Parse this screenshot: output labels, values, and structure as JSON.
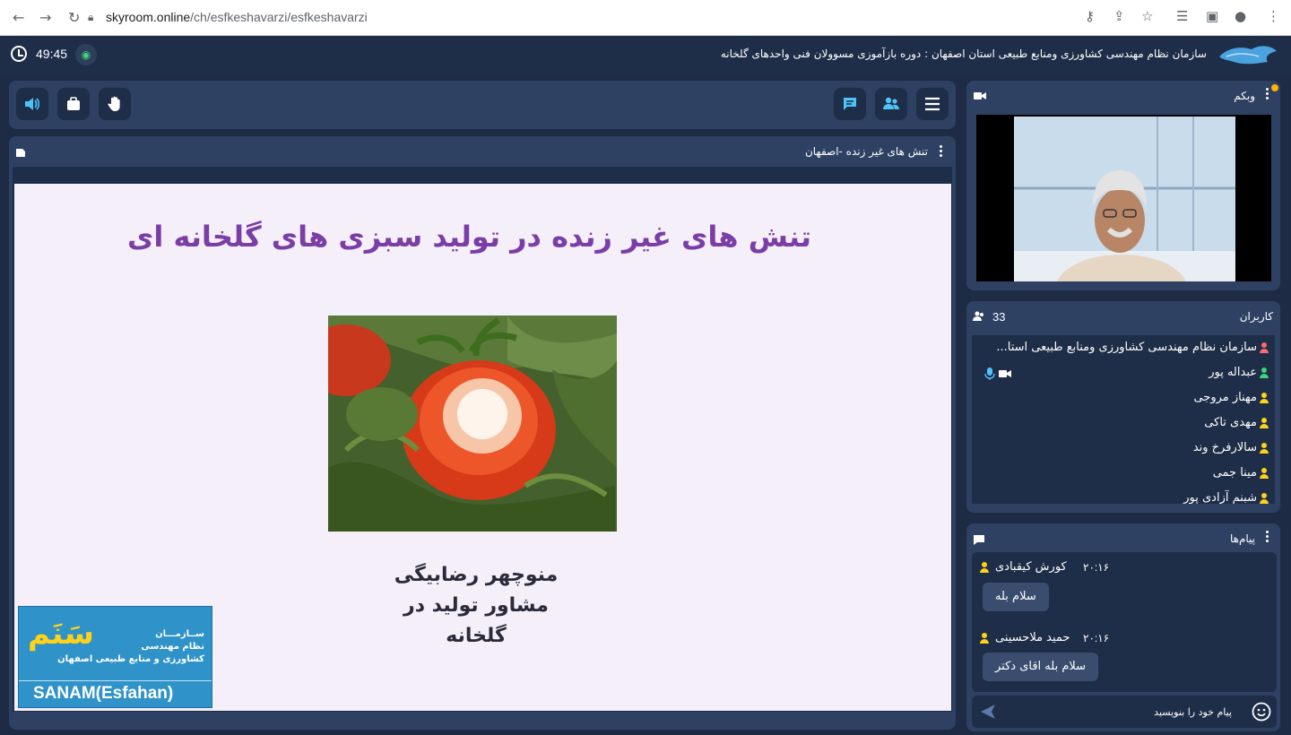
{
  "browser": {
    "url_host": "skyroom.online",
    "url_path": "/ch/esfkeshavarzi/esfkeshavarzi"
  },
  "header": {
    "title": "سازمان نظام مهندسی کشاورزی ومنابع طبیعی استان اصفهان : دوره بازآموزی مسوولان فنی واحدهای گلخانه",
    "timer": "49:45"
  },
  "slide_panel": {
    "title": "تنش های غیر زنده -اصفهان"
  },
  "slide": {
    "title": "تنش های غیر زنده در تولید سبزی های گلخانه ای",
    "presenter_name": "منوچهر رضابیگی",
    "presenter_role": "مشاور تولید در گلخانه"
  },
  "sanam": {
    "big": "سَنَم",
    "line1": "ســازمـــان",
    "line2": "نظام مهندسی",
    "line3": "کشاورزی و منابع طبیعی اصفهان",
    "en": "SANAM(Esfahan)"
  },
  "webcam": {
    "title": "وبکم"
  },
  "users": {
    "title": "کاربران",
    "count": "33",
    "items": [
      {
        "name": "سازمان نظام مهندسی کشاورزی ومنابع طبیعی استا...",
        "color": "#ff6b6b"
      },
      {
        "name": "عبداله پور",
        "color": "#3fd37a"
      },
      {
        "name": "مهناز مروجی",
        "color": "#ffd21a"
      },
      {
        "name": "مهدی تاکی",
        "color": "#ffd21a"
      },
      {
        "name": "سالارفرخ وند",
        "color": "#ffd21a"
      },
      {
        "name": "مینا جمی",
        "color": "#ffd21a"
      },
      {
        "name": "شبنم آزادی پور",
        "color": "#ffd21a"
      }
    ]
  },
  "messages": {
    "title": "پیام‌ها",
    "items": [
      {
        "name": "کورش کیقبادی",
        "time": "۲۰:۱۶",
        "text": "سلام بله"
      },
      {
        "name": "حمید ملاحسینی",
        "time": "۲۰:۱۶",
        "text": "سلام بله اقای دکتر"
      }
    ],
    "placeholder": "پیام خود را بنویسید"
  },
  "colors": {
    "bg": "#1d2b45",
    "panel": "#2e4163",
    "accent_title": "#7a3ea6",
    "online": "#3fd37a"
  }
}
